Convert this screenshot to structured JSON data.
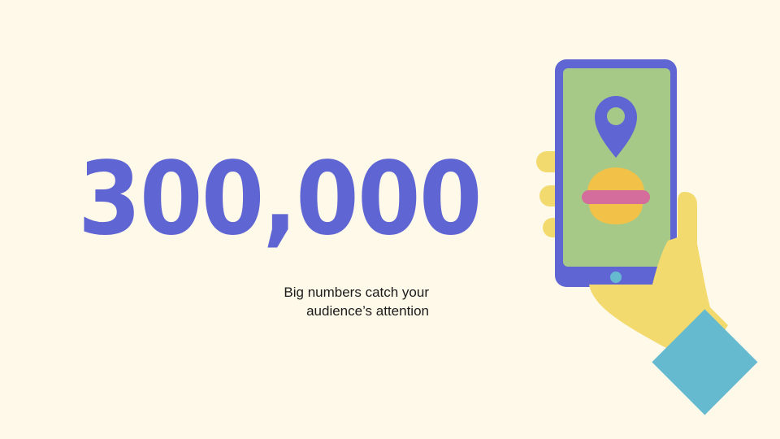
{
  "slide": {
    "big_number": "300,000",
    "caption_line1": "Big numbers catch your",
    "caption_line2": "audience’s attention"
  },
  "colors": {
    "background": "#fef9e8",
    "accent": "#5f66d3",
    "phone_screen": "#a7c988",
    "hand": "#f3da6e",
    "sleeve": "#66bacf",
    "burger_bun": "#f2c148",
    "burger_filling": "#d46c9c",
    "home_button": "#66bacf"
  },
  "icons": {
    "pin": "map-pin-icon",
    "burger": "burger-icon"
  }
}
